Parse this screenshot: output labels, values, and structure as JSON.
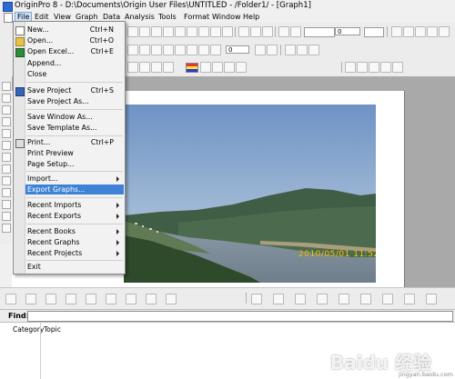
{
  "window": {
    "title": "OriginPro 8 - D:\\Documents\\Origin User Files\\UNTITLED - /Folder1/ - [Graph1]"
  },
  "menubar": {
    "items": [
      "File",
      "Edit",
      "View",
      "Graph",
      "Data",
      "Analysis",
      "Tools",
      "Format",
      "Window",
      "Help"
    ],
    "active": "File"
  },
  "file_menu": {
    "items": [
      {
        "label": "New...",
        "shortcut": "Ctrl+N"
      },
      {
        "label": "Open...",
        "shortcut": "Ctrl+O"
      },
      {
        "label": "Open Excel...",
        "shortcut": "Ctrl+E"
      },
      {
        "label": "Append..."
      },
      {
        "label": "Close"
      },
      {
        "label": "Save Project",
        "shortcut": "Ctrl+S"
      },
      {
        "label": "Save Project As..."
      },
      {
        "label": "Save Window As..."
      },
      {
        "label": "Save Template As..."
      },
      {
        "label": "Print...",
        "shortcut": "Ctrl+P"
      },
      {
        "label": "Print Preview"
      },
      {
        "label": "Page Setup..."
      },
      {
        "label": "Import...",
        "submenu": true
      },
      {
        "label": "Export Graphs...",
        "highlighted": true
      },
      {
        "label": "Recent Imports",
        "submenu": true
      },
      {
        "label": "Recent Exports",
        "submenu": true
      },
      {
        "label": "Recent Books",
        "submenu": true
      },
      {
        "label": "Recent Graphs",
        "submenu": true
      },
      {
        "label": "Recent Projects",
        "submenu": true
      },
      {
        "label": "Exit"
      }
    ]
  },
  "toolbar": {
    "line_width": "0",
    "font_size": "0"
  },
  "graph": {
    "photo_timestamp": "2010/05/01 11:52"
  },
  "find_bar": {
    "label": "Find:",
    "value": ""
  },
  "tabs": {
    "category": "Category",
    "topic": "Topic"
  },
  "watermark": {
    "brand": "Baidu 经验",
    "url": "jingyan.baidu.com"
  },
  "colors": {
    "highlight": "#3d82d6",
    "workspace": "#a9a9a9",
    "menu_bg": "#f2f2f2"
  },
  "icons": [
    "app-icon",
    "document-icon",
    "open-folder-icon",
    "excel-icon",
    "save-icon",
    "print-icon",
    "arrow-pointer-icon",
    "zoom-icon",
    "text-tool-icon",
    "line-tool-icon"
  ]
}
